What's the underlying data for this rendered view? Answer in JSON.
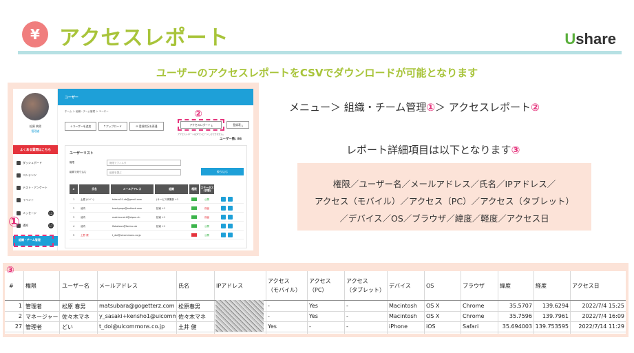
{
  "header": {
    "icon": "yen-icon",
    "icon_glyph": "¥",
    "title": "アクセスレポート",
    "logo_u": "U",
    "logo_rest": "share"
  },
  "subtitle": "ユーザーのアクセスレポートをCSVでダウンロードが可能となります",
  "app": {
    "user_name": "松原 典男",
    "user_role": "管理者",
    "faq_button": "よくある質問はこちら",
    "menu": [
      {
        "label": "ダッシュボード"
      },
      {
        "label": "コンテンツ"
      },
      {
        "label": "テスト・アンケート"
      },
      {
        "label": "イベント"
      },
      {
        "label": "メッセージ",
        "badge": "12"
      },
      {
        "label": "通知",
        "badge": "17"
      }
    ],
    "menu_active": "組織・チーム管理",
    "topbar_title": "ユーザー",
    "breadcrumb": "ホーム ＞ 組織・チーム管理 ＞ ユーザー",
    "buttons": {
      "add_user": "＋ユーザーを追加",
      "upload": "⤒ アップロード",
      "resend": "✉ 登録状況を再通",
      "access_report": "アクセスレポート ⤓",
      "register_list": "登録表 ⤓"
    },
    "note": "アクセスレポートはダウンロードしかできません。",
    "user_count": "ユーザー数: 86",
    "list": {
      "title": "ユーザーリスト",
      "filter1_label": "権限",
      "filter1_placeholder": "権限でフィルタ",
      "filter2_label": "組織で絞り込む",
      "filter2_placeholder": "組織を選ぶ",
      "search_button": "絞り込む",
      "columns": [
        "#",
        "氏名",
        "メールアドレス",
        "組織",
        "権限",
        "ステータス(状態)"
      ],
      "rows": [
        {
          "no": "1",
          "name": "土肥 (ﾒﾝﾊﾞｰ)",
          "email": "takeru01.ub@gmail.com",
          "org": "(サービス事業部 +1",
          "status": "公開"
        },
        {
          "no": "2",
          "name": "池内",
          "email": "toschpopo@outlook.com",
          "org": "技術 +1",
          "status": "保留"
        },
        {
          "no": "3",
          "name": "池内",
          "email": "makimuraLit@alpen.ch",
          "org": "技術 +1",
          "status": "保留"
        },
        {
          "no": "4",
          "name": "池内",
          "email": "flokatoun@fonico.ub",
          "org": "技術 +1",
          "status": "公開"
        },
        {
          "no": "5",
          "name": "上野 健",
          "email": "t_doi@uicommons.co.jp",
          "org": "",
          "status": "公開"
        }
      ]
    }
  },
  "callouts": {
    "one": "①",
    "two": "②",
    "three": "③"
  },
  "right": {
    "path_prefix": "メニュー＞ 組織・チーム管理",
    "path_marker1": "①",
    "path_middle": "＞ アクセスレポート",
    "path_marker2": "②",
    "detail_text": "レポート詳細項目は以下となります",
    "detail_marker": "③",
    "items": [
      "権限／ユーザー名／メールアドレス／氏名／IPアドレス／",
      "アクセス（モバイル）／アクセス（PC）／アクセス（タブレット）",
      "／デバイス／OS／ブラウザ／緯度／軽度／アクセス日"
    ]
  },
  "csv": {
    "headers": [
      "#",
      "権限",
      "ユーザー名",
      "メールアドレス",
      "氏名",
      "IPアドレス",
      "アクセス\n（モバイル）",
      "アクセス\n（PC）",
      "アクセス\n（タブレット）",
      "デバイス",
      "OS",
      "ブラウザ",
      "緯度",
      "経度",
      "アクセス日"
    ],
    "rows": [
      [
        "1",
        "管理者",
        "松原 春男",
        "matsubara@gogetterz.com",
        "松原春男",
        "",
        "-",
        "Yes",
        "-",
        "Macintosh",
        "OS X",
        "Chrome",
        "35.5707",
        "139.6294",
        "2022/7/4 15:25"
      ],
      [
        "2",
        "マネージャー",
        "佐々木マネ",
        "y_sasaki+kensho1@uicommo",
        "佐々木マネ",
        "",
        "-",
        "Yes",
        "-",
        "Macintosh",
        "OS X",
        "Chrome",
        "35.7596",
        "139.7961",
        "2022/7/4 16:09"
      ],
      [
        "27",
        "管理者",
        "どい",
        "t_doi@uicommons.co.jp",
        "土井 健",
        "",
        "Yes",
        "-",
        "-",
        "iPhone",
        "iOS",
        "Safari",
        "35.694003",
        "139.753595",
        "2022/7/14 11:29"
      ]
    ]
  }
}
